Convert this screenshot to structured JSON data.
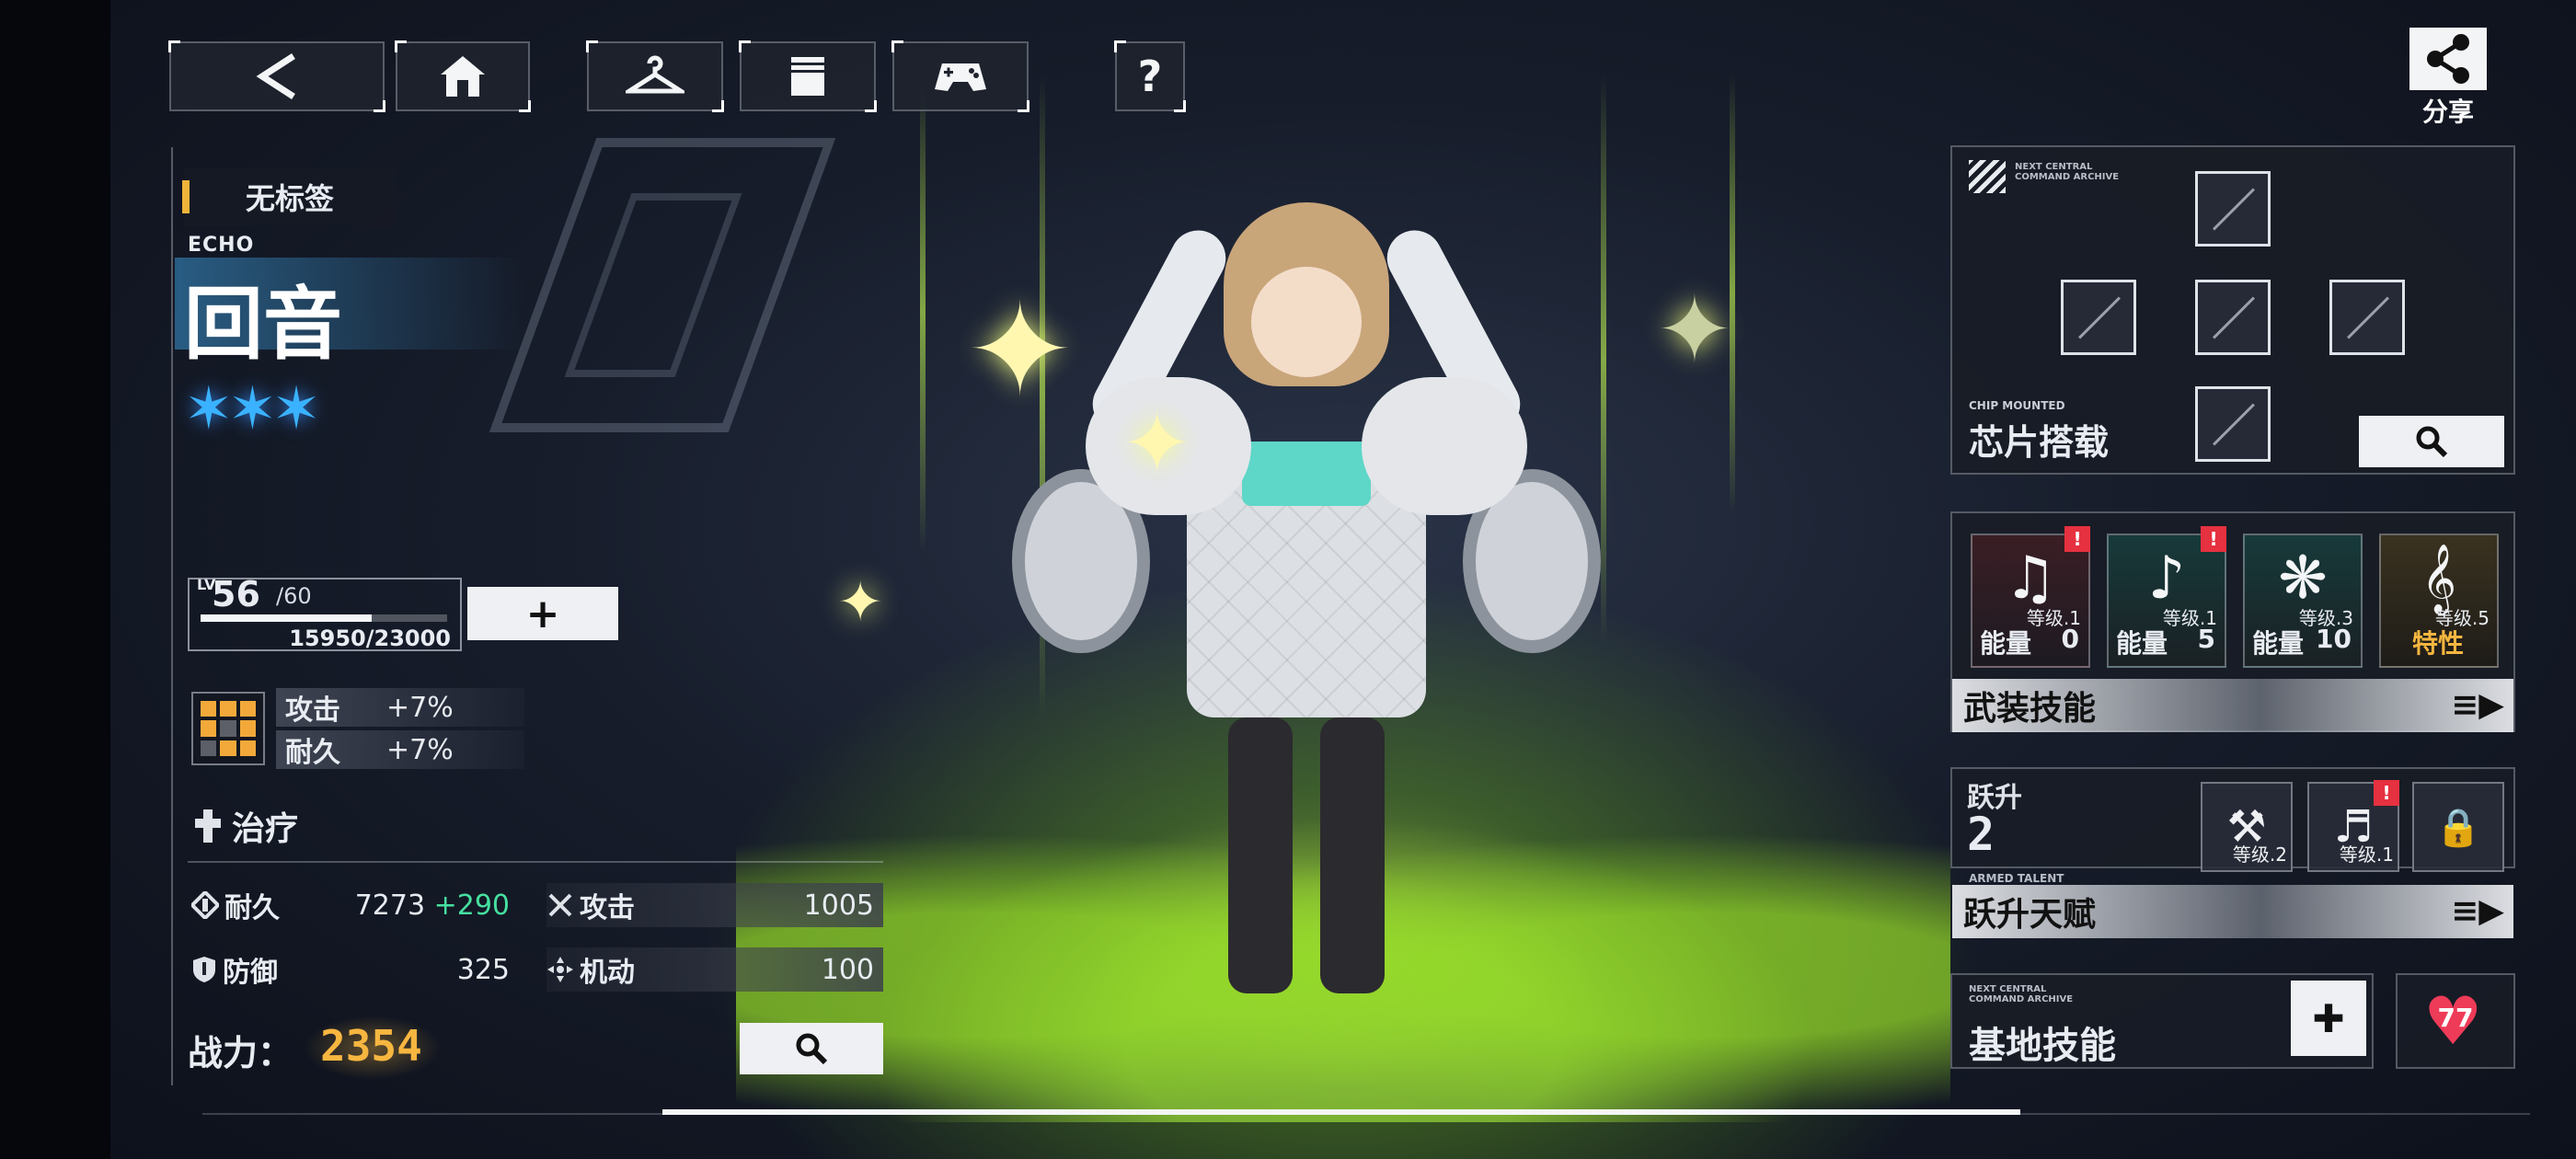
{
  "topbar": {
    "back_icon": "chevron-left-icon",
    "home_icon": "home-icon",
    "wardrobe_icon": "hanger-icon",
    "archive_icon": "book-icon",
    "game_icon": "gamepad-icon",
    "help_label": "?",
    "share_label": "分享"
  },
  "character": {
    "tag": "无标签",
    "name_en": "ECHO",
    "name_cn": "回音",
    "stars": "✶✶✶",
    "level_prefix": "LV",
    "level": "56",
    "level_max": "/60",
    "xp_text": "15950/23000",
    "xp_fraction": 0.6935,
    "level_up_label": "+",
    "buffs": [
      {
        "label": "攻击",
        "value": "+7%"
      },
      {
        "label": "耐久",
        "value": "+7%"
      }
    ],
    "role": "治疗",
    "stats": {
      "durability_label": "耐久",
      "durability_value": "7273",
      "durability_bonus": "+290",
      "attack_label": "攻击",
      "attack_value": "1005",
      "defense_label": "防御",
      "defense_value": "325",
      "mobility_label": "机动",
      "mobility_value": "100"
    },
    "power_label": "战力：",
    "power_value": "2354"
  },
  "chip": {
    "header_small": "NEXT CENTRAL COMMAND ARCHIVE",
    "sub_label": "CHIP MOUNTED",
    "title": "芯片搭载"
  },
  "skills": {
    "cards": [
      {
        "glyph": "♫",
        "level": "等级.1",
        "energy_label": "能量",
        "energy": "0",
        "alert": "!"
      },
      {
        "glyph": "♪",
        "level": "等级.1",
        "energy_label": "能量",
        "energy": "5",
        "alert": "!"
      },
      {
        "glyph": "❋",
        "level": "等级.3",
        "energy_label": "能量",
        "energy": "10"
      },
      {
        "glyph": "𝄞",
        "level": "等级.5",
        "energy_label": "特性",
        "energy": ""
      }
    ],
    "armed_title": "武装技能"
  },
  "ascension": {
    "label": "跃升",
    "value": "2",
    "sub_label": "ARMED TALENT",
    "cards": [
      {
        "glyph": "⚒",
        "level": "等级.2"
      },
      {
        "glyph": "♬",
        "level": "等级.1",
        "alert": "!"
      },
      {
        "glyph": "🔒",
        "level": ""
      }
    ],
    "title": "跃升天赋"
  },
  "base": {
    "header_small": "NEXT CENTRAL COMMAND ARCHIVE",
    "title": "基地技能",
    "affinity": "77"
  },
  "colors": {
    "accent_gold": "#f7b640",
    "star_blue": "#3ab2ff",
    "bonus_green": "#46e0a0",
    "alert_red": "#e63140",
    "heart_red": "#ee3b58"
  }
}
